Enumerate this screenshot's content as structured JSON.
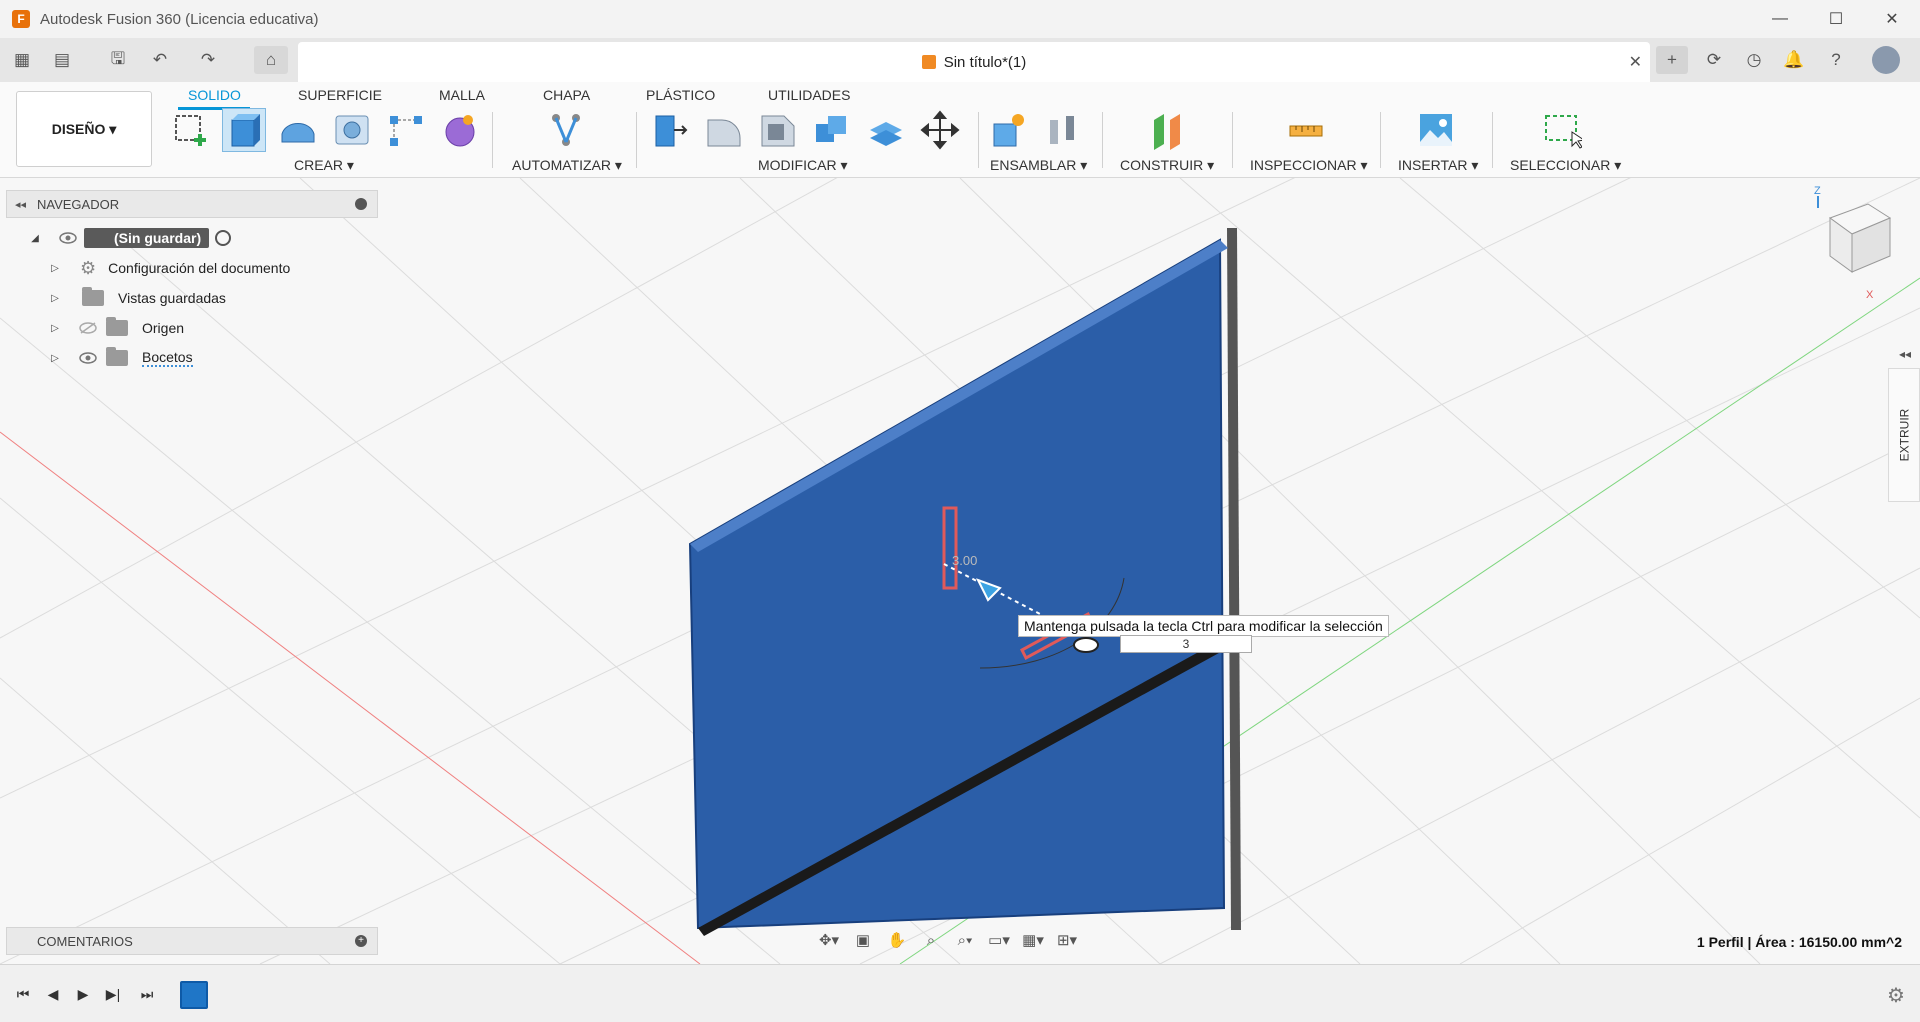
{
  "window": {
    "title": "Autodesk Fusion 360 (Licencia educativa)",
    "logo_letter": "F",
    "minimize": "—",
    "maximize": "☐",
    "close": "✕"
  },
  "tabbar": {
    "doc_title": "Sin título*(1)",
    "close": "✕"
  },
  "ribbon": {
    "workspace_button": "DISEÑO ▾",
    "tabs": [
      "SOLIDO",
      "SUPERFICIE",
      "MALLA",
      "CHAPA",
      "PLÁSTICO",
      "UTILIDADES"
    ],
    "active_tab": "SOLIDO",
    "groups": {
      "crear": "CREAR ▾",
      "automatizar": "AUTOMATIZAR ▾",
      "modificar": "MODIFICAR ▾",
      "ensamblar": "ENSAMBLAR ▾",
      "construir": "CONSTRUIR ▾",
      "inspeccionar": "INSPECCIONAR ▾",
      "insertar": "INSERTAR ▾",
      "seleccionar": "SELECCIONAR ▾"
    }
  },
  "navigator": {
    "title": "NAVEGADOR",
    "root": "(Sin guardar)",
    "items": [
      {
        "label": "Configuración del documento"
      },
      {
        "label": "Vistas guardadas"
      },
      {
        "label": "Origen"
      },
      {
        "label": "Bocetos"
      }
    ]
  },
  "comments": {
    "title": "COMENTARIOS"
  },
  "viewport": {
    "tooltip": "Mantenga pulsada la tecla Ctrl para modificar la selección",
    "distance_value": "3",
    "dim_label": "3.00"
  },
  "right_panel": {
    "extrude_label": "EXTRUIR",
    "toggle": "◂◂"
  },
  "status": {
    "text": "1 Perfil | Área : 16150.00 mm^2"
  },
  "colors": {
    "accent": "#0696d7",
    "panel_blue": "#2b5ea8",
    "selection_red": "#e05a5a"
  }
}
